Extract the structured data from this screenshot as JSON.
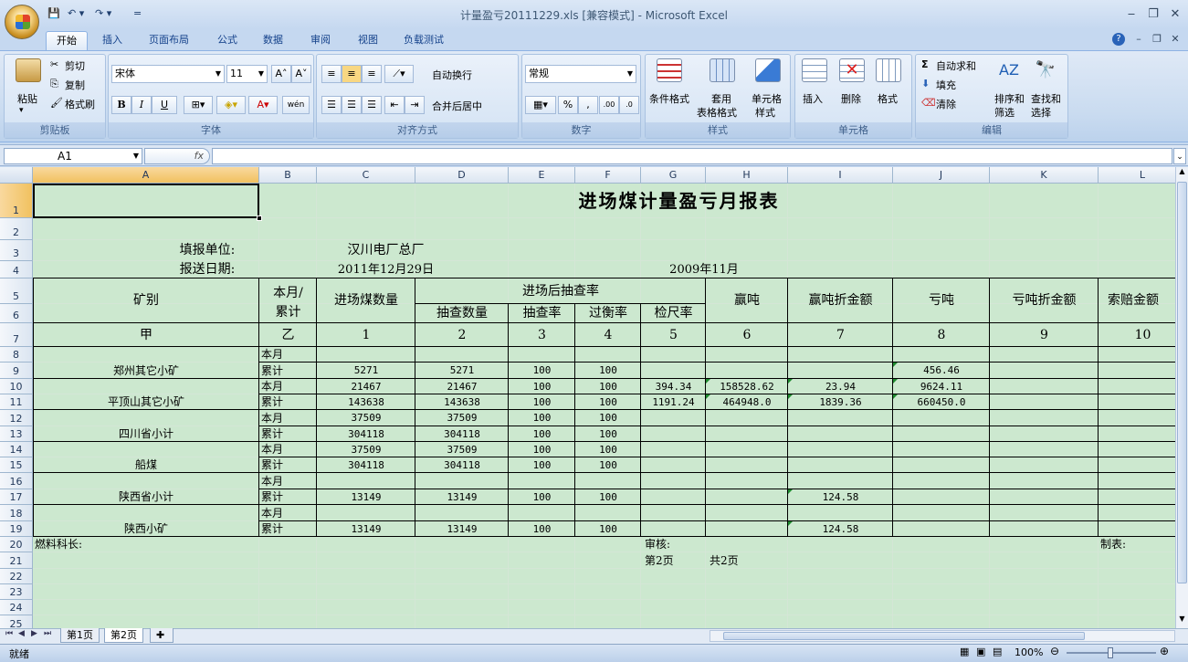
{
  "window": {
    "title": "计量盈亏20111229.xls  [兼容模式] - Microsoft Excel"
  },
  "qat": {
    "save": "💾",
    "undo": "↶ ▾",
    "redo": "↷ ▾",
    "more": "="
  },
  "tabs": [
    "开始",
    "插入",
    "页面布局",
    "公式",
    "数据",
    "审阅",
    "视图",
    "负载测试"
  ],
  "ribbon": {
    "clipboard": {
      "title": "剪贴板",
      "paste": "粘贴",
      "cut": "剪切",
      "copy": "复制",
      "format_painter": "格式刷"
    },
    "font": {
      "title": "字体",
      "name": "宋体",
      "size": "11",
      "bold": "B",
      "italic": "I",
      "underline": "U",
      "grow": "A˄",
      "shrink": "A˅",
      "wen": "wén"
    },
    "alignment": {
      "title": "对齐方式",
      "wrap": "自动换行",
      "merge": "合并后居中"
    },
    "number": {
      "title": "数字",
      "format": "常规",
      "percent": "%",
      "comma": ",",
      "inc": ".00",
      "dec": ".0"
    },
    "styles": {
      "title": "样式",
      "cond": "条件格式",
      "table1": "套用",
      "table2": "表格格式",
      "cell1": "单元格",
      "cell2": "样式"
    },
    "cells": {
      "title": "单元格",
      "insert": "插入",
      "delete": "删除",
      "format": "格式"
    },
    "editing": {
      "title": "编辑",
      "autosum": "自动求和",
      "fill": "填充",
      "clear": "清除",
      "sort1": "排序和",
      "sort2": "筛选",
      "find1": "查找和",
      "find2": "选择"
    }
  },
  "formula_bar": {
    "name_box": "A1",
    "fx": "fx",
    "value": ""
  },
  "columns": [
    "A",
    "B",
    "C",
    "D",
    "E",
    "F",
    "G",
    "H",
    "I",
    "J",
    "K",
    "L"
  ],
  "rows": [
    "1",
    "2",
    "3",
    "4",
    "5",
    "6",
    "7",
    "8",
    "9",
    "10",
    "11",
    "12",
    "13",
    "14",
    "15",
    "16",
    "17",
    "18",
    "19",
    "20",
    "21",
    "22",
    "23",
    "24",
    "25"
  ],
  "report": {
    "title": "进场煤计量盈亏月报表",
    "unit_label": "填报单位:",
    "unit_value": "汉川电厂总厂",
    "date_label": "报送日期:",
    "date_value": "2011年12月29日",
    "period": "2009年11月",
    "headers": {
      "mine": "矿别",
      "period1": "本月/",
      "period2": "累计",
      "qty": "进场煤数量",
      "sample": "进场后抽查率",
      "sample_qty": "抽查数量",
      "sample_rate": "抽查率",
      "scale_rate": "过衡率",
      "ruler_rate": "检尺率",
      "gain": "赢吨",
      "gain_amt": "赢吨折金额",
      "loss": "亏吨",
      "loss_amt": "亏吨折金额",
      "claim": "索赔金额"
    },
    "codes": [
      "甲",
      "乙",
      "1",
      "2",
      "3",
      "4",
      "5",
      "6",
      "7",
      "8",
      "9",
      "10"
    ],
    "groups": [
      {
        "name": "郑州其它小矿",
        "rows": [
          [
            "本月",
            "",
            "",
            "",
            "",
            "",
            "",
            "",
            "",
            ""
          ],
          [
            "累计",
            "5271",
            "5271",
            "100",
            "100",
            "",
            "",
            "",
            "456.46",
            ""
          ]
        ]
      },
      {
        "name": "平顶山其它小矿",
        "rows": [
          [
            "本月",
            "21467",
            "21467",
            "100",
            "100",
            "394.34",
            "158528.62",
            "23.94",
            "9624.11",
            ""
          ],
          [
            "累计",
            "143638",
            "143638",
            "100",
            "100",
            "1191.24",
            "464948.0",
            "1839.36",
            "660450.0",
            ""
          ]
        ]
      },
      {
        "name": "四川省小计",
        "rows": [
          [
            "本月",
            "37509",
            "37509",
            "100",
            "100",
            "",
            "",
            "",
            "",
            ""
          ],
          [
            "累计",
            "304118",
            "304118",
            "100",
            "100",
            "",
            "",
            "",
            "",
            ""
          ]
        ]
      },
      {
        "name": "船煤",
        "rows": [
          [
            "本月",
            "37509",
            "37509",
            "100",
            "100",
            "",
            "",
            "",
            "",
            ""
          ],
          [
            "累计",
            "304118",
            "304118",
            "100",
            "100",
            "",
            "",
            "",
            "",
            ""
          ]
        ]
      },
      {
        "name": "陕西省小计",
        "rows": [
          [
            "本月",
            "",
            "",
            "",
            "",
            "",
            "",
            "",
            "",
            ""
          ],
          [
            "累计",
            "13149",
            "13149",
            "100",
            "100",
            "",
            "",
            "124.58",
            "",
            ""
          ]
        ]
      },
      {
        "name": "陕西小矿",
        "rows": [
          [
            "本月",
            "",
            "",
            "",
            "",
            "",
            "",
            "",
            "",
            ""
          ],
          [
            "累计",
            "13149",
            "13149",
            "100",
            "100",
            "",
            "",
            "124.58",
            "",
            ""
          ]
        ]
      }
    ],
    "footer": {
      "fuel": "燃料科长:",
      "review": "审核:",
      "maker": "制表:",
      "page": "第2页",
      "total": "共2页"
    }
  },
  "sheet_tabs": [
    "第1页",
    "第2页"
  ],
  "status": {
    "ready": "就绪",
    "zoom": "100%"
  }
}
